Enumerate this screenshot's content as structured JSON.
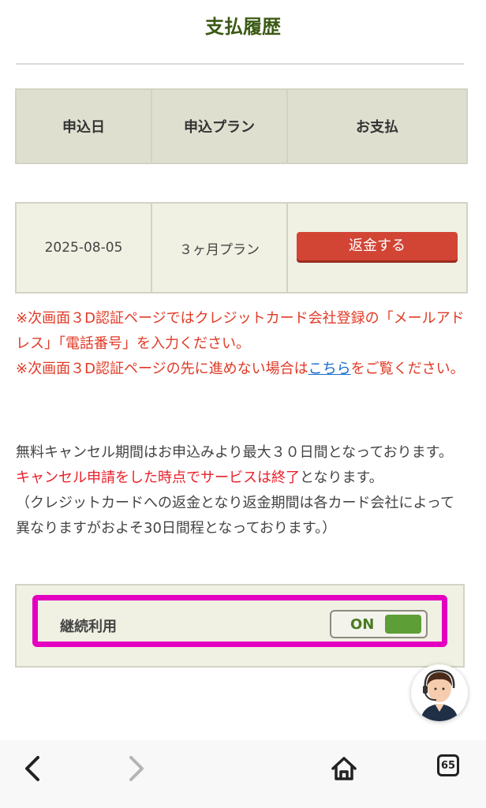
{
  "page": {
    "title": "支払履歴"
  },
  "history_table": {
    "headers": [
      "申込日",
      "申込プラン",
      "お支払"
    ],
    "rows": [
      {
        "date": "2025-08-05",
        "plan": "３ヶ月プラン",
        "action_label": "返金する"
      }
    ]
  },
  "notes": {
    "line1": "※次画面３D認証ページではクレジットカード会社登録の「メールアドレス」「電話番号」を入力ください。",
    "line2_before": "※次画面３D認証ページの先に進めない場合は",
    "line2_link": "こちら",
    "line2_after": "をご覧ください。"
  },
  "cancel_info": {
    "line1": "無料キャンセル期間はお申込みより最大３０日間となっております。",
    "line2_red": "キャンセル申請をした時点でサービスは終了",
    "line2_rest": "となります。",
    "line3": "（クレジットカードへの返金となり返金期間は各カード会社によって異なりますがおよそ30日間程となっております。）"
  },
  "continuous_use": {
    "label": "継続利用",
    "state": "ON"
  },
  "browser_bar": {
    "tab_count": "65"
  },
  "colors": {
    "title": "#3b5a14",
    "refund_button": "#d24535",
    "note_red": "#e03a26",
    "link": "#1a6ccc",
    "highlight": "#e400c0",
    "toggle_on": "#5d9e36"
  },
  "icons": {
    "back": "chevron-left-icon",
    "forward": "chevron-right-icon",
    "home": "home-icon",
    "tabs": "tabs-icon",
    "support": "support-agent-icon"
  }
}
